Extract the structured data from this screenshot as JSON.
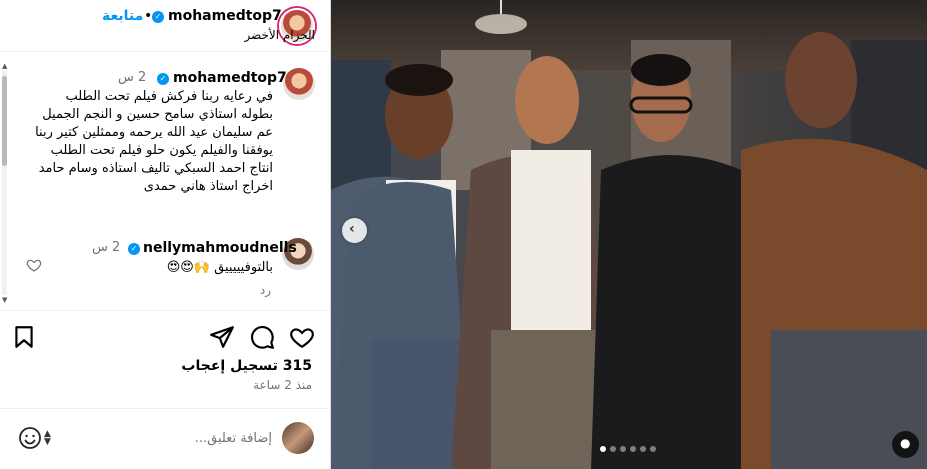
{
  "header": {
    "username": "mohamedtop7",
    "follow_label": "متابعة",
    "dot": "•",
    "subtitle": "الحزام الأخضر"
  },
  "comments": [
    {
      "username": "mohamedtop7",
      "time": "2 س",
      "text": "في رعايه ربنا فركش فيلم تحت الطلب بطوله استاذي سامح حسين و النجم الجميل عم سليمان عيد الله يرحمه وممثلين كتير ربنا يوفقنا والفيلم يكون حلو فيلم تحت الطلب انتاج احمد السبكي تاليف استاذه وسام حامد اخراج استاذ هاني حمدى"
    },
    {
      "username": "nellymahmoudnells",
      "time": "2 س",
      "text": "بالتوفيييييق 🙌😍😍",
      "reply_label": "رد"
    }
  ],
  "post": {
    "likes_label": "315 تسجيل إعجاب",
    "time_ago": "منذ 2 ساعة",
    "comment_placeholder": "إضافة تعليق..."
  },
  "carousel": {
    "prev_icon": "‹",
    "dot_count": 6,
    "active_dot": 0,
    "tag_icon": "user-tag-icon"
  },
  "colors": {
    "link_blue": "#0095f6",
    "muted": "#737373",
    "border": "#dbdbdb"
  }
}
